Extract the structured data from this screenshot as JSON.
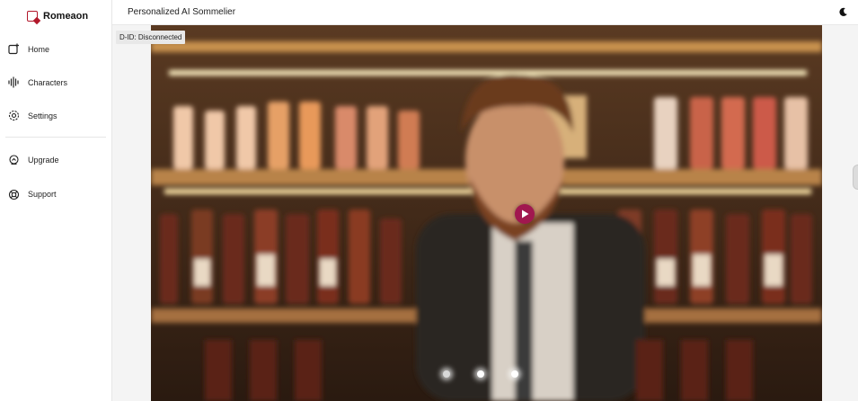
{
  "brand": {
    "name": "Romeaon",
    "accent": "#b2182b"
  },
  "sidebar": {
    "items": [
      {
        "label": "Home",
        "icon": "home-add-icon"
      },
      {
        "label": "Characters",
        "icon": "waveform-icon"
      },
      {
        "label": "Settings",
        "icon": "gear-icon"
      }
    ],
    "secondary": [
      {
        "label": "Upgrade",
        "icon": "upgrade-icon"
      },
      {
        "label": "Support",
        "icon": "lifebuoy-icon"
      }
    ]
  },
  "header": {
    "title": "Personalized AI Sommelier",
    "theme_icon": "moon-icon"
  },
  "video": {
    "status": "D-ID: Disconnected",
    "play_color": "#a1174f",
    "description_hidden": true
  }
}
